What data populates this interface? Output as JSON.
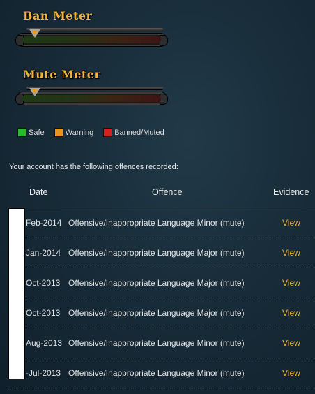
{
  "ban_meter": {
    "title": "Ban Meter",
    "level": 0.09
  },
  "mute_meter": {
    "title": "Mute Meter",
    "level": 0.09
  },
  "legend": [
    {
      "label": "Safe",
      "color": "#2db82d"
    },
    {
      "label": "Warning",
      "color": "#e8951c"
    },
    {
      "label": "Banned/Muted",
      "color": "#d42121"
    }
  ],
  "intro_text": "Your account has the following offences recorded:",
  "table": {
    "headers": {
      "date": "Date",
      "offence": "Offence",
      "evidence": "Evidence"
    },
    "rows": [
      {
        "date": "Feb-2014",
        "offence": "Offensive/Inappropriate Language Minor (mute)",
        "evidence": "View"
      },
      {
        "date": "Jan-2014",
        "offence": "Offensive/Inappropriate Language Major (mute)",
        "evidence": "View"
      },
      {
        "date": "Oct-2013",
        "offence": "Offensive/Inappropriate Language Major (mute)",
        "evidence": "View"
      },
      {
        "date": "Oct-2013",
        "offence": "Offensive/Inappropriate Language Major (mute)",
        "evidence": "View"
      },
      {
        "date": "Aug-2013",
        "offence": "Offensive/Inappropriate Language Minor (mute)",
        "evidence": "View"
      },
      {
        "date": "-Jul-2013",
        "offence": "Offensive/Inappropriate Language Minor (mute)",
        "evidence": "View"
      }
    ]
  }
}
